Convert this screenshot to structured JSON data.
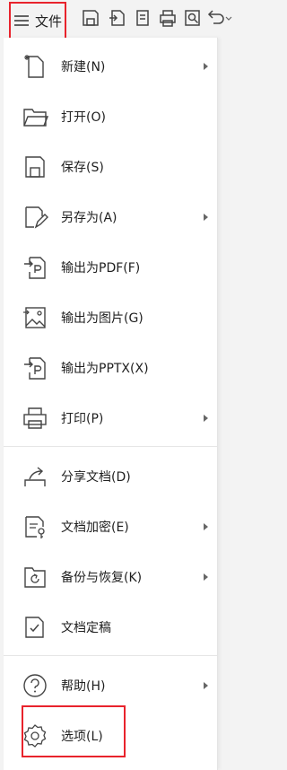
{
  "toolbar": {
    "file_menu_label": "文件",
    "icons": [
      "save-icon",
      "export-icon",
      "print-preview-icon",
      "print-icon",
      "find-icon",
      "undo-icon"
    ]
  },
  "menu": {
    "items": [
      {
        "label": "新建(N)",
        "icon": "new-file-icon",
        "submenu": true
      },
      {
        "label": "打开(O)",
        "icon": "open-folder-icon",
        "submenu": false
      },
      {
        "label": "保存(S)",
        "icon": "save-icon",
        "submenu": false
      },
      {
        "label": "另存为(A)",
        "icon": "save-as-icon",
        "submenu": true
      },
      {
        "label": "输出为PDF(F)",
        "icon": "export-pdf-icon",
        "submenu": false
      },
      {
        "label": "输出为图片(G)",
        "icon": "export-image-icon",
        "submenu": false
      },
      {
        "label": "输出为PPTX(X)",
        "icon": "export-pptx-icon",
        "submenu": false
      },
      {
        "label": "打印(P)",
        "icon": "print-icon",
        "submenu": true
      },
      {
        "label": "分享文档(D)",
        "icon": "share-icon",
        "submenu": false
      },
      {
        "label": "文档加密(E)",
        "icon": "encrypt-icon",
        "submenu": true
      },
      {
        "label": "备份与恢复(K)",
        "icon": "backup-icon",
        "submenu": true
      },
      {
        "label": "文档定稿",
        "icon": "finalize-icon",
        "submenu": false
      },
      {
        "label": "帮助(H)",
        "icon": "help-icon",
        "submenu": true
      },
      {
        "label": "选项(L)",
        "icon": "gear-icon",
        "submenu": false
      }
    ]
  },
  "colors": {
    "highlight": "#e8232c",
    "icon_stroke": "#444444"
  }
}
